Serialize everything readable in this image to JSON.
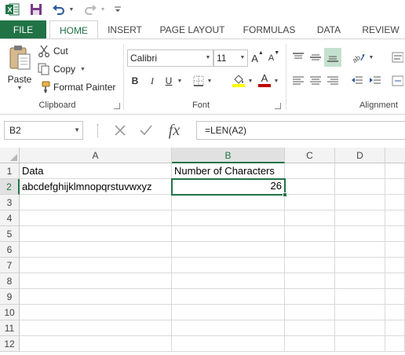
{
  "qat": {
    "app_icon": "excel-icon",
    "save_icon": "save-icon",
    "undo_icon": "undo-icon",
    "redo_icon": "redo-icon",
    "customize_icon": "customize-icon"
  },
  "tabs": {
    "file": "FILE",
    "home": "HOME",
    "insert": "INSERT",
    "page_layout": "PAGE LAYOUT",
    "formulas": "FORMULAS",
    "data": "DATA",
    "review": "REVIEW"
  },
  "clipboard": {
    "paste": "Paste",
    "cut": "Cut",
    "copy": "Copy",
    "format_painter": "Format Painter",
    "group_label": "Clipboard"
  },
  "font": {
    "name": "Calibri",
    "size": "11",
    "grow": "A",
    "shrink": "A",
    "bold": "B",
    "italic": "I",
    "underline": "U",
    "font_color_letter": "A",
    "group_label": "Font"
  },
  "alignment": {
    "group_label": "Alignment"
  },
  "formula_bar": {
    "name_box": "B2",
    "fx": "fx",
    "formula": "=LEN(A2)"
  },
  "sheet": {
    "columns": [
      "A",
      "B",
      "C",
      "D"
    ],
    "rows": [
      "1",
      "2",
      "3",
      "4",
      "5",
      "6",
      "7",
      "8",
      "9",
      "10",
      "11",
      "12"
    ],
    "a1": "Data",
    "b1": "Number of Characters",
    "a2": "abcdefghijklmnopqrstuvwxyz",
    "b2": "26"
  },
  "colors": {
    "accent": "#217346",
    "font_highlight": "#ffff00",
    "font_color": "#c00000"
  }
}
